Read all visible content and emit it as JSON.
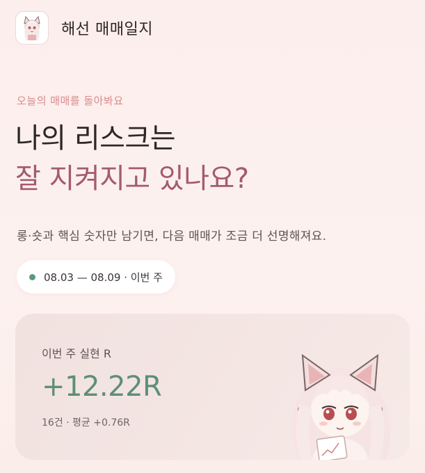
{
  "header": {
    "app_title": "해선 매매일지",
    "app_icon": "mascot-logo-icon"
  },
  "hero": {
    "eyebrow": "오늘의 매매를 돌아봐요",
    "headline_line1": "나의 리스크는",
    "headline_line2": "잘 지켜지고 있나요?",
    "subtitle": "롱·숏과 핵심 숫자만 남기면, 다음 매매가 조금 더 선명해져요."
  },
  "range": {
    "label": "08.03 — 08.09 · 이번 주",
    "dot_color": "#5a9a7c"
  },
  "summary_card": {
    "label": "이번 주 실현 R",
    "value": "+12.22R",
    "meta": "16건 · 평균 +0.76R",
    "value_color": "#5c8f76"
  },
  "colors": {
    "accent_pink": "#d98a8d",
    "accent_rose": "#a45c6a"
  }
}
